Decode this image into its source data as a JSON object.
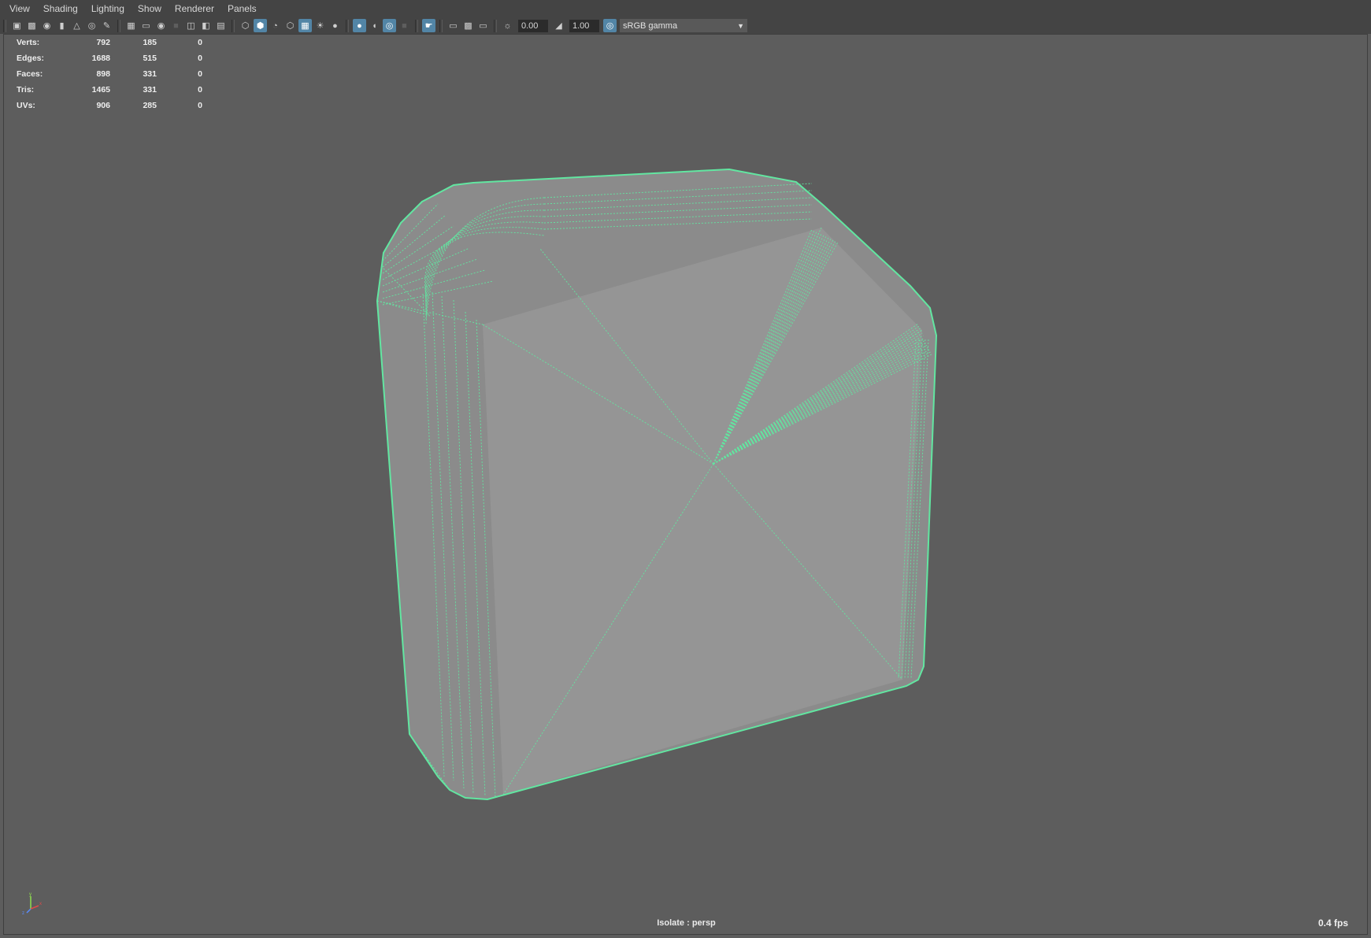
{
  "menubar": {
    "items": [
      {
        "label": "View"
      },
      {
        "label": "Shading"
      },
      {
        "label": "Lighting"
      },
      {
        "label": "Show"
      },
      {
        "label": "Renderer"
      },
      {
        "label": "Panels"
      }
    ]
  },
  "toolbar": {
    "exposure_value": "0.00",
    "gamma_value": "1.00",
    "color_space": "sRGB gamma",
    "icons": [
      "camera-icon",
      "camera-attributes-icon",
      "bookmark-icon",
      "image-plane-icon",
      "grid-icon",
      "film-gate-icon",
      "resolution-gate-icon",
      "wireframe-icon",
      "smooth-shade-icon",
      "textured-icon",
      "lighting-icon",
      "shadows-icon",
      "isolate-select-icon",
      "xray-icon",
      "exposure-icon",
      "gamma-icon",
      "color-management-icon"
    ]
  },
  "hud": {
    "rows": [
      {
        "label": "Verts:",
        "c1": "792",
        "c2": "185",
        "c3": "0"
      },
      {
        "label": "Edges:",
        "c1": "1688",
        "c2": "515",
        "c3": "0"
      },
      {
        "label": "Faces:",
        "c1": "898",
        "c2": "331",
        "c3": "0"
      },
      {
        "label": "Tris:",
        "c1": "1465",
        "c2": "331",
        "c3": "0"
      },
      {
        "label": "UVs:",
        "c1": "906",
        "c2": "285",
        "c3": "0"
      }
    ]
  },
  "viewport": {
    "isolate_label": "Isolate : persp",
    "fps": "0.4 fps",
    "wire_color": "#62e6a1",
    "face_color": "#959595",
    "side_color": "#8b8b8b",
    "background": "#5d5d5d"
  },
  "axis": {
    "x_label": "x",
    "y_label": "y",
    "z_label": "z"
  }
}
